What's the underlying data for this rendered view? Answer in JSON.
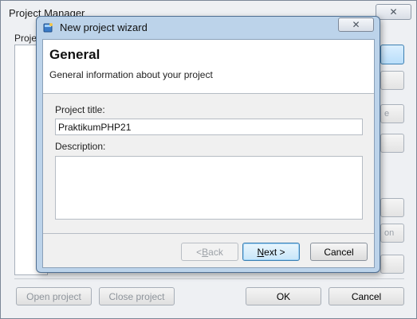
{
  "project_manager": {
    "title": "Project Manager",
    "group_label": "Projec",
    "side_button_ghost_label": "e",
    "side_button_ghost2_label": "on",
    "open_project_label": "Open project",
    "close_project_label": "Close project",
    "ok_label": "OK",
    "cancel_label": "Cancel"
  },
  "wizard": {
    "title": "New project wizard",
    "header_title": "General",
    "header_subtitle": "General information about your project",
    "project_title_label": "Project title:",
    "project_title_value": "PraktikumPHP21",
    "description_label": "Description:",
    "description_value": "",
    "back_label_prefix": "< ",
    "back_label_mnemonic": "B",
    "back_label_rest": "ack",
    "next_label_mnemonic": "N",
    "next_label_rest": "ext >",
    "cancel_label": "Cancel"
  },
  "icons": {
    "close": "close-icon",
    "wizard_window": "wizard-window-icon"
  }
}
